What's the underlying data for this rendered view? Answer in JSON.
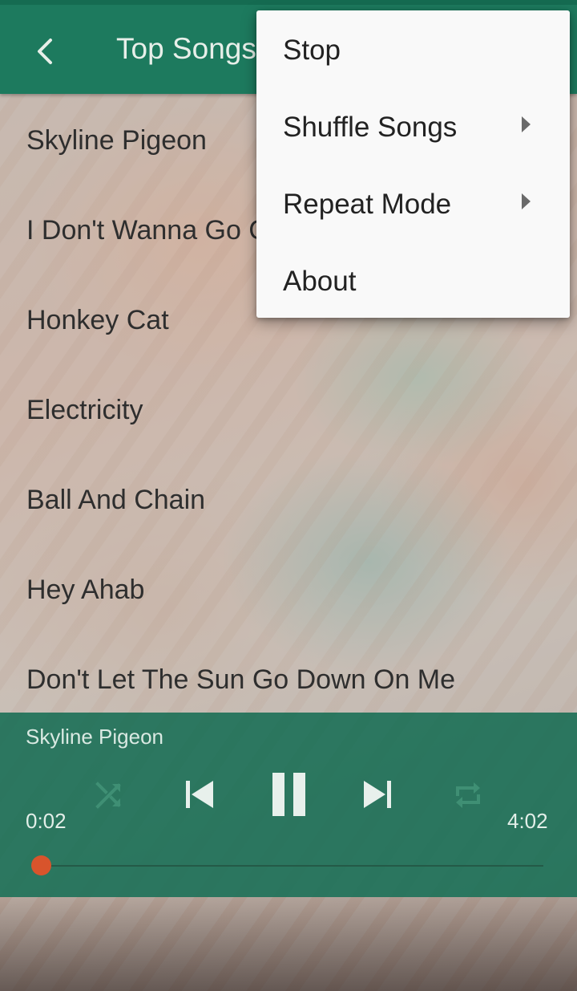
{
  "app_bar": {
    "title": "Top Songs",
    "back_icon": "chevron-left-icon",
    "color": "#1d7a5e"
  },
  "songs": [
    "Skyline Pigeon",
    "I Don't Wanna Go O",
    "Honkey Cat",
    "Electricity",
    "Ball And Chain",
    "Hey Ahab",
    "Don't Let The Sun Go Down On Me"
  ],
  "player": {
    "now_playing": "Skyline Pigeon",
    "elapsed": "0:02",
    "duration": "4:02",
    "progress_fraction": 0.008,
    "icons": [
      "shuffle-icon",
      "skip-previous-icon",
      "pause-icon",
      "skip-next-icon",
      "repeat-icon"
    ],
    "accent": "#d8542c"
  },
  "menu": {
    "items": [
      {
        "label": "Stop",
        "has_submenu": false
      },
      {
        "label": "Shuffle Songs",
        "has_submenu": true
      },
      {
        "label": "Repeat Mode",
        "has_submenu": true
      },
      {
        "label": "About",
        "has_submenu": false
      }
    ]
  }
}
